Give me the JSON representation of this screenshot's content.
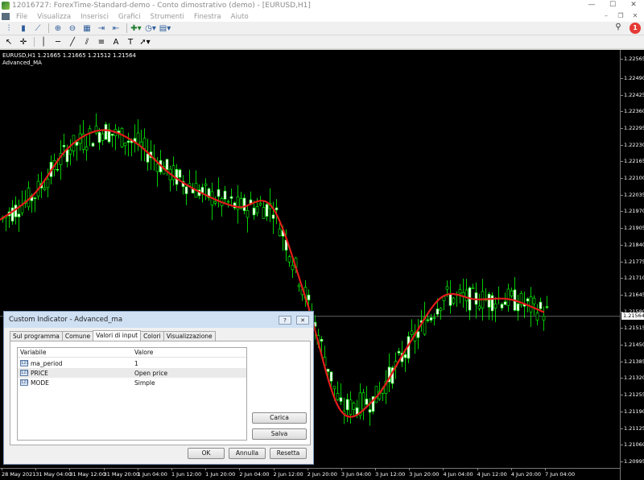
{
  "window": {
    "title": "12016727: ForexTime-Standard-demo - Conto dimostrativo (demo) - [EURUSD,H1]",
    "minimize": "—",
    "maximize": "☐",
    "close": "✕"
  },
  "menu": [
    "File",
    "Visualizza",
    "Inserisci",
    "Grafici",
    "Strumenti",
    "Finestra",
    "Aiuto"
  ],
  "menu_controls": {
    "minimize": "–",
    "restore": "❐",
    "close": "✕"
  },
  "notifications": {
    "count": "1"
  },
  "chart": {
    "info_line": "EURUSD,H1  1.21665 1.21665 1.21512 1.21564",
    "indicator": "Advanced_MA",
    "current_price": "1.21564",
    "price_labels": [
      "1.22565",
      "1.22490",
      "1.22425",
      "1.22360",
      "1.22295",
      "1.22230",
      "1.22165",
      "1.22100",
      "1.22035",
      "1.21970",
      "1.21905",
      "1.21840",
      "1.21775",
      "1.21710",
      "1.21645",
      "1.21580",
      "1.21515",
      "1.21450",
      "1.21385",
      "1.21320",
      "1.21255",
      "1.21190",
      "1.21125",
      "1.21060",
      "1.20995"
    ],
    "time_labels": [
      "28 May 2021",
      "31 May 04:00",
      "31 May 12:00",
      "31 May 20:00",
      "1 Jun 04:00",
      "1 Jun 12:00",
      "1 Jun 20:00",
      "2 Jun 04:00",
      "2 Jun 12:00",
      "2 Jun 20:00",
      "3 Jun 04:00",
      "3 Jun 12:00",
      "3 Jun 20:00",
      "4 Jun 04:00",
      "4 Jun 12:00",
      "4 Jun 20:00",
      "7 Jun 04:00"
    ],
    "colors": {
      "background": "#000000",
      "bull": "#000000",
      "bear": "#ffffff",
      "wick": "#00ff00",
      "ma": "#e31b1b"
    }
  },
  "chart_data": {
    "type": "line",
    "symbol": "EURUSD",
    "timeframe": "H1",
    "ohlc_last": {
      "open": 1.21665,
      "high": 1.21665,
      "low": 1.21512,
      "close": 1.21564
    },
    "series": [
      {
        "name": "Advanced_MA",
        "x": [
          "28 May 2021",
          "31 May 04:00",
          "31 May 12:00",
          "31 May 20:00",
          "1 Jun 04:00",
          "1 Jun 12:00",
          "1 Jun 20:00",
          "2 Jun 04:00",
          "2 Jun 12:00",
          "2 Jun 20:00",
          "3 Jun 04:00",
          "3 Jun 12:00",
          "3 Jun 20:00",
          "4 Jun 04:00",
          "4 Jun 12:00",
          "4 Jun 20:00",
          "7 Jun 04:00"
        ],
        "values": [
          1.2194,
          1.2204,
          1.2222,
          1.2229,
          1.2224,
          1.2212,
          1.2204,
          1.2199,
          1.2199,
          1.2163,
          1.212,
          1.2124,
          1.2145,
          1.2164,
          1.2163,
          1.2163,
          1.2158
        ]
      }
    ],
    "price_min": 1.20995,
    "price_max": 1.22565
  },
  "dialog": {
    "title": "Custom Indicator - Advanced_ma",
    "help": "?",
    "close": "✕",
    "tabs": [
      "Sul programma",
      "Comune",
      "Valori di input",
      "Colori",
      "Visualizzazione"
    ],
    "active_tab": 2,
    "headers": {
      "variable": "Variabile",
      "value": "Valore"
    },
    "rows": [
      {
        "icon": "123",
        "variable": "ma_period",
        "value": "1"
      },
      {
        "icon": "123",
        "variable": "PRICE",
        "value": "Open price"
      },
      {
        "icon": "123",
        "variable": "MODE",
        "value": "Simple"
      }
    ],
    "buttons": {
      "load": "Carica",
      "save": "Salva",
      "ok": "OK",
      "cancel": "Annulla",
      "reset": "Resetta"
    }
  }
}
